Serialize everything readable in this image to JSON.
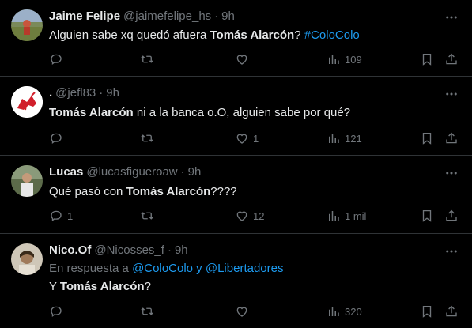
{
  "tweets": [
    {
      "name": "Jaime Felipe",
      "handle": "@jaimefelipe_hs",
      "dot": "·",
      "time": "9h",
      "text_before": "Alguien sabe xq quedó afuera ",
      "text_bold": "Tomás Alarcón",
      "text_after": "? ",
      "hashtag": "#ColoColo",
      "replies": "",
      "retweets": "",
      "likes": "",
      "views": "109"
    },
    {
      "name": ".",
      "handle": "@jefl83",
      "dot": "·",
      "time": "9h",
      "text_bold": "Tomás Alarcón",
      "text_after": " ni a la banca o.O, alguien sabe por qué?",
      "replies": "",
      "retweets": "",
      "likes": "1",
      "views": "121"
    },
    {
      "name": "Lucas",
      "handle": "@lucasfigueroaw",
      "dot": "·",
      "time": "9h",
      "text_before": "Qué pasó con ",
      "text_bold": "Tomás Alarcón",
      "text_after": "????",
      "replies": "1",
      "retweets": "",
      "likes": "12",
      "views": "1 mil"
    },
    {
      "name": "Nico.Of",
      "handle": "@Nicosses_f",
      "dot": "·",
      "time": "9h",
      "reply_prefix": "En respuesta a ",
      "reply_user1": "@ColoColo",
      "reply_and": " y ",
      "reply_user2": "@Libertadores",
      "text_before": "Y ",
      "text_bold": "Tomás Alarcón",
      "text_after": "?",
      "replies": "",
      "retweets": "",
      "likes": "",
      "views": "320"
    }
  ],
  "colors": {
    "background": "#000000",
    "text": "#e7e9ea",
    "muted": "#71767b",
    "link": "#1d9bf0",
    "border": "#2f3336"
  }
}
